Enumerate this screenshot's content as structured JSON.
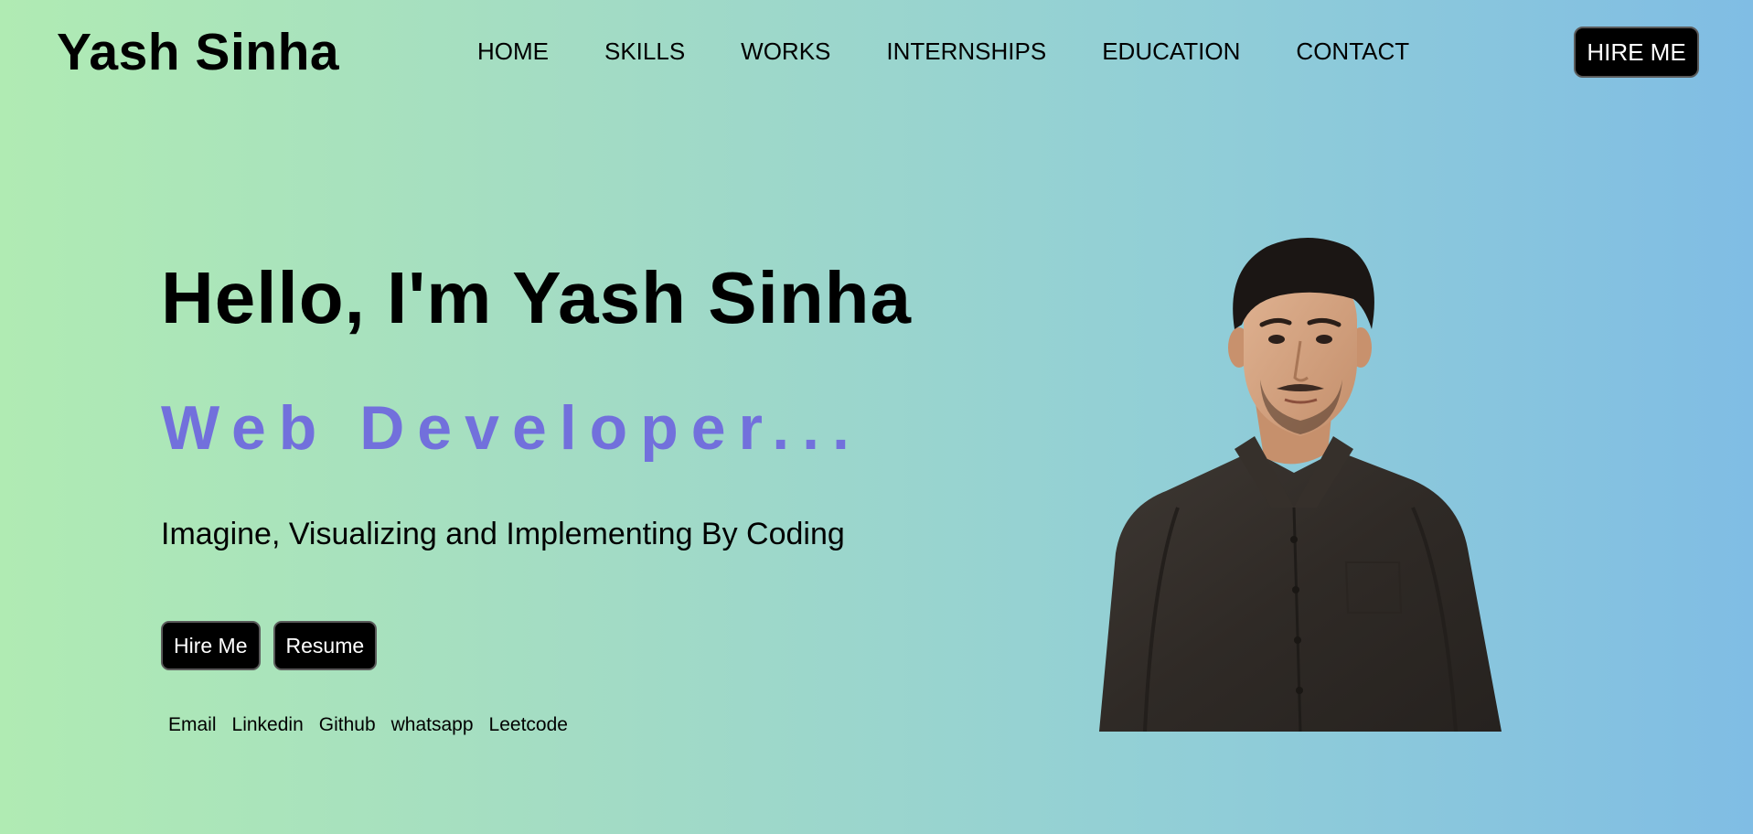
{
  "header": {
    "brand": "Yash Sinha",
    "nav": [
      {
        "label": "HOME"
      },
      {
        "label": "SKILLS"
      },
      {
        "label": "WORKS"
      },
      {
        "label": "INTERNSHIPS"
      },
      {
        "label": "EDUCATION"
      },
      {
        "label": "CONTACT"
      }
    ],
    "cta_label": "HIRE ME"
  },
  "hero": {
    "greeting": "Hello, I'm Yash Sinha",
    "role": "Web Developer...",
    "tagline": "Imagine, Visualizing and Implementing By Coding",
    "buttons": {
      "hire_label": "Hire Me",
      "resume_label": "Resume"
    },
    "social_links": [
      {
        "label": "Email"
      },
      {
        "label": "Linkedin"
      },
      {
        "label": "Github"
      },
      {
        "label": "whatsapp"
      },
      {
        "label": "Leetcode"
      }
    ]
  },
  "colors": {
    "accent": "#7270dc",
    "button_bg": "#000000",
    "gradient_start": "#b0ebb3",
    "gradient_end": "#80bde4"
  }
}
